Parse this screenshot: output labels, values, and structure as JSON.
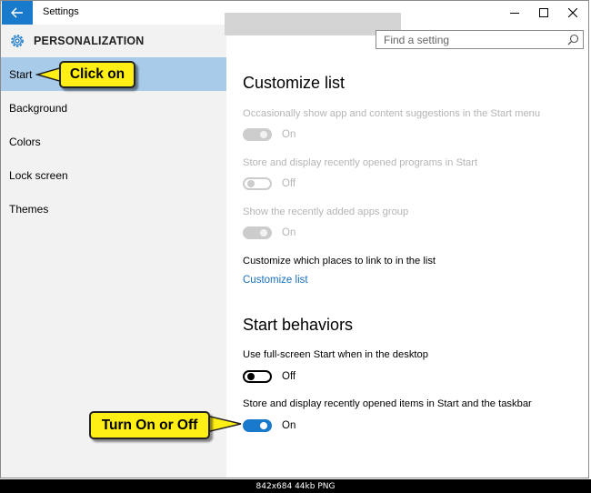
{
  "window": {
    "app_title": "Settings",
    "icons": {
      "back": "back-arrow-icon",
      "minimize": "minimize-icon",
      "maximize": "maximize-icon",
      "close": "close-icon"
    }
  },
  "sidebar": {
    "section_icon": "gear-icon",
    "section_title": "PERSONALIZATION",
    "items": [
      {
        "label": "Start",
        "selected": true
      },
      {
        "label": "Background",
        "selected": false
      },
      {
        "label": "Colors",
        "selected": false
      },
      {
        "label": "Lock screen",
        "selected": false
      },
      {
        "label": "Themes",
        "selected": false
      }
    ]
  },
  "search": {
    "placeholder": "Find a setting",
    "icon": "search-icon"
  },
  "main": {
    "customize_heading": "Customize list",
    "options": [
      {
        "label": "Occasionally show app and content suggestions in the Start menu",
        "state": "On",
        "enabled": false
      },
      {
        "label": "Store and display recently opened programs in Start",
        "state": "Off",
        "enabled": false
      },
      {
        "label": "Show the recently added apps group",
        "state": "On",
        "enabled": false
      }
    ],
    "places_label": "Customize which places to link to in the list",
    "places_link": "Customize list",
    "behaviors_heading": "Start behaviors",
    "behaviors": [
      {
        "label": "Use full-screen Start when in the desktop",
        "state": "Off",
        "enabled": true
      },
      {
        "label": "Store and display recently opened items in Start and the taskbar",
        "state": "On",
        "enabled": true
      }
    ]
  },
  "annotations": {
    "click_on": "Click on",
    "turn_on_off": "Turn On or Off"
  },
  "footer": {
    "caption": "842x684  44kb  PNG"
  },
  "colors": {
    "accent": "#1979ca",
    "selected_nav": "#a8cbea",
    "callout": "#ffef15",
    "sidebar_bg": "#f2f2f2"
  }
}
